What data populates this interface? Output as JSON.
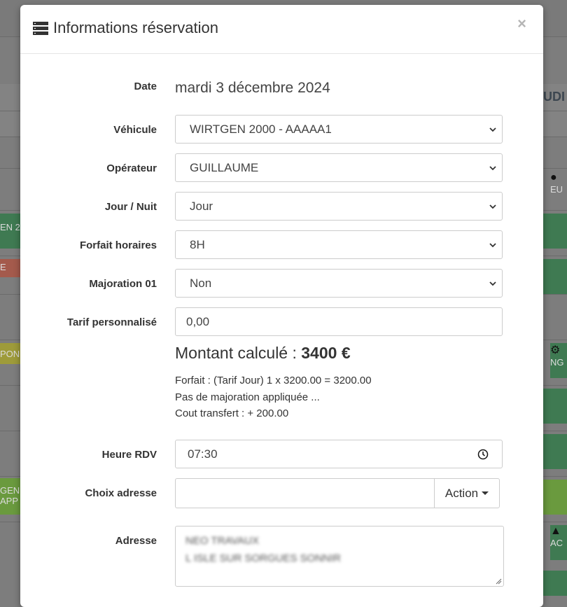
{
  "background": {
    "chips": [
      {
        "text": "EN 2",
        "color": "#3f7a52"
      },
      {
        "text": "E",
        "color": "#a45a4c"
      },
      {
        "text": "PONI",
        "color": "#9e9b3a"
      },
      {
        "text": "GEN",
        "color": "#6a9a3e"
      },
      {
        "text": "APP",
        "color": "#6a9a3e"
      },
      {
        "text": "UDI",
        "color": "#5a6a7a"
      },
      {
        "text": "EU",
        "color": "#6e6e6e"
      },
      {
        "text": "NG",
        "color": "#3f7a52"
      },
      {
        "text": "AC",
        "color": "#3f7a52"
      }
    ]
  },
  "modal": {
    "title": "Informations réservation",
    "close_label": "×",
    "date_label": "Date",
    "date_value": "mardi 3 décembre 2024",
    "fields": {
      "vehicule": {
        "label": "Véhicule",
        "value": "WIRTGEN 2000 - AAAAA1"
      },
      "operateur": {
        "label": "Opérateur",
        "value": "GUILLAUME"
      },
      "jour_nuit": {
        "label": "Jour / Nuit",
        "value": "Jour"
      },
      "forfait": {
        "label": "Forfait horaires",
        "value": "8H"
      },
      "majoration": {
        "label": "Majoration 01",
        "value": "Non"
      },
      "tarif": {
        "label": "Tarif personnalisé",
        "value": "0,00"
      }
    },
    "montant_prefix": "Montant calculé : ",
    "montant_value": "3400 €",
    "details": [
      "Forfait : (Tarif Jour) 1 x 3200.00 = 3200.00",
      "Pas de majoration appliquée ...",
      "Cout transfert : + 200.00"
    ],
    "heure_label": "Heure RDV",
    "heure_value": "07:30",
    "choix_label": "Choix adresse",
    "choix_value": "",
    "action_label": "Action",
    "adresse_label": "Adresse",
    "adresse_lines": [
      "NEO TRAVAUX",
      "L ISLE SUR SORGUES SONNIR"
    ]
  }
}
